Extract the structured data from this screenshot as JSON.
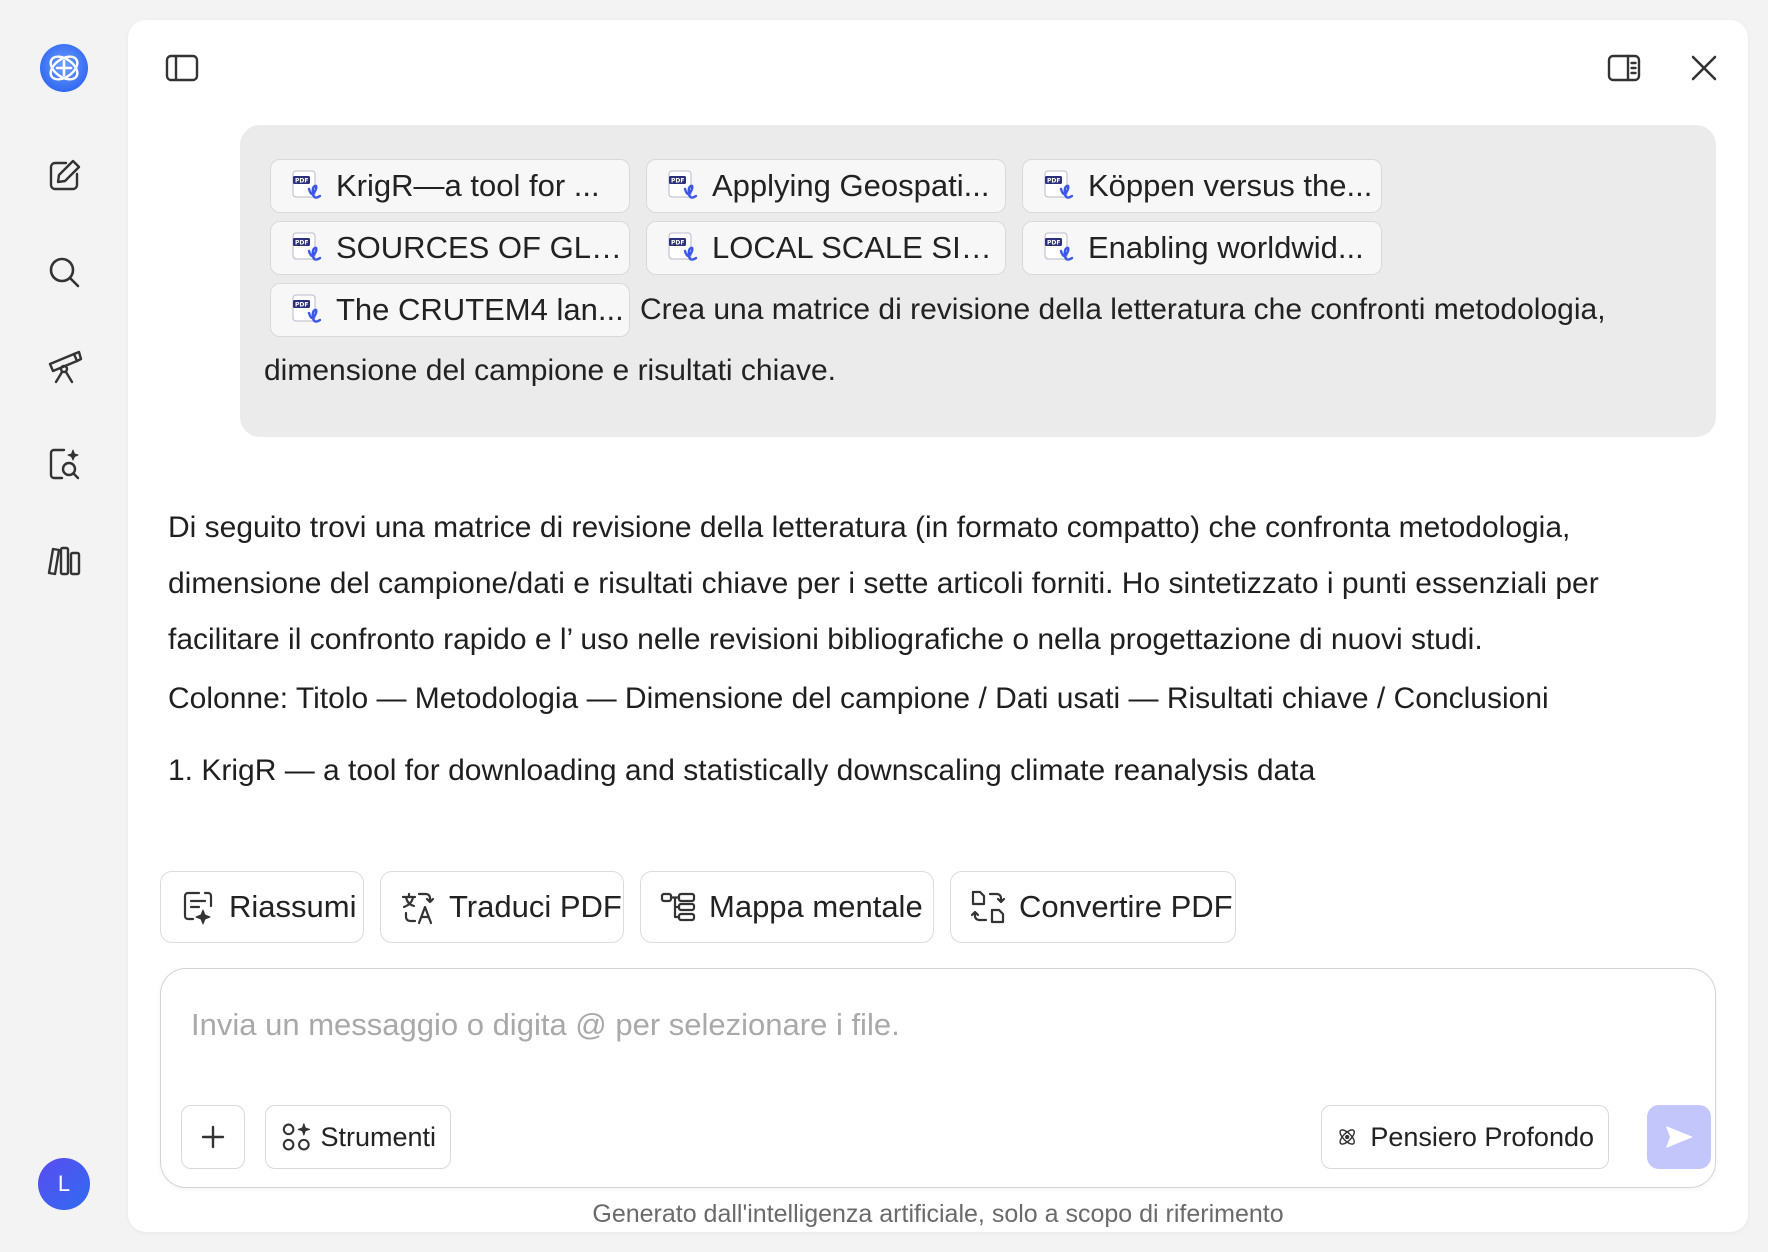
{
  "rail": {
    "avatar_letter": "L"
  },
  "user_message": {
    "attachments": [
      "KrigR—a tool for ...",
      "Applying Geospati...",
      "Köppen versus the...",
      "SOURCES OF GLO...",
      "LOCAL SCALE SIM...",
      "Enabling worldwid...",
      "The CRUTEM4 lan..."
    ],
    "text_line1": "Crea una matrice di revisione della letteratura che confronti metodologia,",
    "text_line2": "dimensione del campione e risultati chiave."
  },
  "answer": {
    "intro": "Di seguito trovi una matrice di revisione della letteratura (in formato compatto) che confronta metodologia, dimensione del campione/dati e risultati chiave per i sette articoli forniti. Ho sintetizzato i punti essenziali per facilitare il confronto rapido e l’ uso nelle revisioni bibliografiche o nella progettazione di nuovi studi.",
    "columns": "Colonne: Titolo — Metodologia — Dimensione del campione / Dati usati — Risultati chiave / Conclusioni",
    "item1": "1. KrigR — a tool for downloading and statistically downscaling climate reanalysis data"
  },
  "actions": {
    "summarize": "Riassumi",
    "translate": "Traduci PDF",
    "mindmap": "Mappa mentale",
    "convert": "Convertire PDF"
  },
  "composer": {
    "placeholder": "Invia un messaggio o digita @ per selezionare i file.",
    "tools_label": "Strumenti",
    "deep_think_label": "Pensiero Profondo"
  },
  "disclaimer": "Generato dall'intelligenza artificiale, solo a scopo di riferimento",
  "colors": {
    "accent": "#5b5ff0",
    "send_disabled": "#c3c6fb"
  }
}
